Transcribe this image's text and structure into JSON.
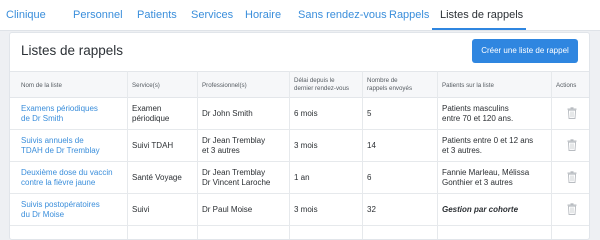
{
  "nav": {
    "tabs": [
      {
        "label": "Clinique"
      },
      {
        "label": "Personnel"
      },
      {
        "label": "Patients"
      },
      {
        "label": "Services"
      },
      {
        "label": "Horaire"
      },
      {
        "label": "Sans rendez-vous"
      },
      {
        "label": "Rappels"
      },
      {
        "label": "Listes de rappels",
        "active": true
      }
    ]
  },
  "page": {
    "title": "Listes de rappels",
    "create_button": "Créer une liste de rappel"
  },
  "table": {
    "headers": [
      {
        "line1": "Nom de la liste",
        "line2": ""
      },
      {
        "line1": "Service(s)",
        "line2": ""
      },
      {
        "line1": "Professionnel(s)",
        "line2": ""
      },
      {
        "line1": "Délai depuis le",
        "line2": "dernier rendez-vous"
      },
      {
        "line1": "Nombre de",
        "line2": "rappels envoyés"
      },
      {
        "line1": "Patients sur la liste",
        "line2": ""
      },
      {
        "line1": "Actions",
        "line2": ""
      }
    ],
    "rows": [
      {
        "name": [
          "Examens périodiques",
          "de Dr Smith"
        ],
        "service": [
          "Examen",
          "périodique"
        ],
        "professionals": [
          "Dr John Smith",
          ""
        ],
        "delay": "6 mois",
        "reminders": "5",
        "patients": [
          "Patients masculins",
          "entre 70 et 120 ans."
        ]
      },
      {
        "name": [
          "Suivis annuels de",
          "TDAH de Dr Tremblay"
        ],
        "service": [
          "Suivi TDAH",
          ""
        ],
        "professionals": [
          "Dr Jean Tremblay",
          "et 3 autres"
        ],
        "delay": "3 mois",
        "reminders": "14",
        "patients": [
          "Patients entre 0 et 12 ans",
          "et 3 autres."
        ]
      },
      {
        "name": [
          "Deuxième dose du vaccin",
          "contre la fièvre jaune"
        ],
        "service": [
          "Santé Voyage",
          ""
        ],
        "professionals": [
          "Dr Jean Tremblay",
          "Dr Vincent Laroche"
        ],
        "delay": "1 an",
        "reminders": "6",
        "patients": [
          "Fannie Marleau, Mélissa",
          "Gonthier et 3 autres"
        ]
      },
      {
        "name": [
          "Suivis postopératoires",
          "du Dr Moise"
        ],
        "service": [
          "Suivi",
          ""
        ],
        "professionals": [
          "Dr Paul Moise",
          ""
        ],
        "delay": "3 mois",
        "reminders": "32",
        "patients": [
          "Gestion par cohorte",
          ""
        ]
      }
    ]
  },
  "colors": {
    "accent": "#2f86e0",
    "link": "#3a8edb",
    "background": "#eef0f3"
  }
}
